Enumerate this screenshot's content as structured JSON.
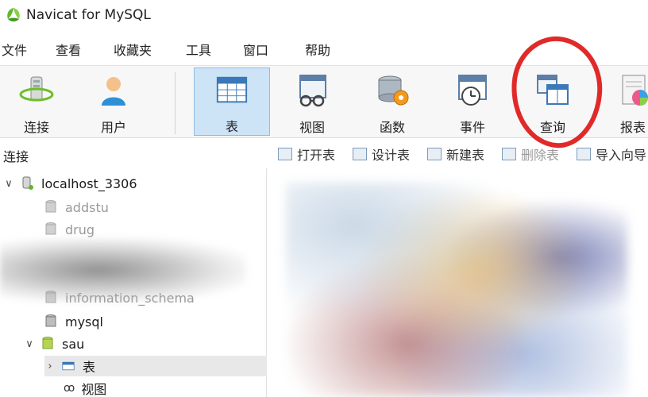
{
  "window": {
    "title": "Navicat for MySQL"
  },
  "menu": [
    "文件",
    "查看",
    "收藏夹",
    "工具",
    "窗口",
    "帮助"
  ],
  "toolbar": [
    {
      "label": "连接",
      "icon": "connection-icon"
    },
    {
      "label": "用户",
      "icon": "user-icon"
    },
    {
      "label": "表",
      "icon": "table-icon",
      "active": true
    },
    {
      "label": "视图",
      "icon": "view-icon"
    },
    {
      "label": "函数",
      "icon": "function-icon"
    },
    {
      "label": "事件",
      "icon": "event-icon"
    },
    {
      "label": "查询",
      "icon": "query-icon"
    },
    {
      "label": "报表",
      "icon": "report-icon"
    }
  ],
  "connections_panel": {
    "title": "连接"
  },
  "object_toolbar": [
    "打开表",
    "设计表",
    "新建表",
    "删除表",
    "导入向导"
  ],
  "tree": {
    "connection": "localhost_3306",
    "databases": [
      "addstu",
      "drug",
      "information_schema",
      "mysql",
      "sau"
    ],
    "sau_children": [
      "表",
      "视图"
    ]
  },
  "colors": {
    "accent": "#cde4f7",
    "annotation": "#e02a2a"
  }
}
